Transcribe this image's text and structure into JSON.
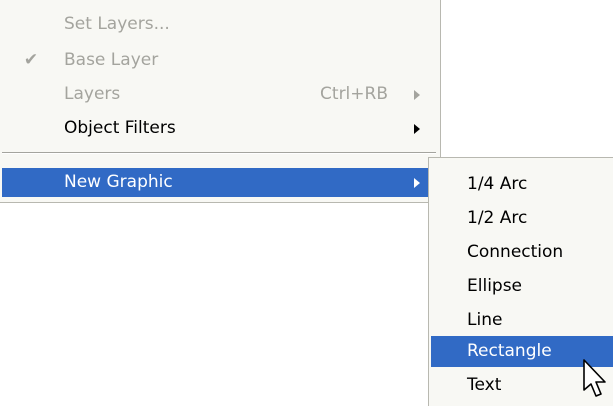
{
  "main_menu": {
    "items": [
      {
        "label": "Set Layers...",
        "shortcut": "",
        "checked": false,
        "disabled": true,
        "submenu": false
      },
      {
        "label": "Base Layer",
        "shortcut": "",
        "checked": true,
        "check_mark": "✔",
        "disabled": true,
        "submenu": false
      },
      {
        "label": "Layers",
        "shortcut": "Ctrl+RB",
        "checked": false,
        "disabled": true,
        "submenu": true
      },
      {
        "label": "Object Filters",
        "shortcut": "",
        "checked": false,
        "disabled": false,
        "submenu": true
      },
      {
        "label": "New Graphic",
        "shortcut": "",
        "checked": false,
        "disabled": false,
        "submenu": true,
        "highlighted": true
      }
    ]
  },
  "sub_menu": {
    "items": [
      {
        "label": "1/4 Arc"
      },
      {
        "label": "1/2 Arc"
      },
      {
        "label": "Connection"
      },
      {
        "label": "Ellipse"
      },
      {
        "label": "Line"
      },
      {
        "label": "Rectangle",
        "highlighted": true
      },
      {
        "label": "Text"
      }
    ]
  },
  "colors": {
    "menu_background": "#f8f8f4",
    "highlight": "#316ac5",
    "disabled_text": "#a4a49e"
  },
  "cursor": {
    "icon": "arrow-pointer-icon"
  }
}
